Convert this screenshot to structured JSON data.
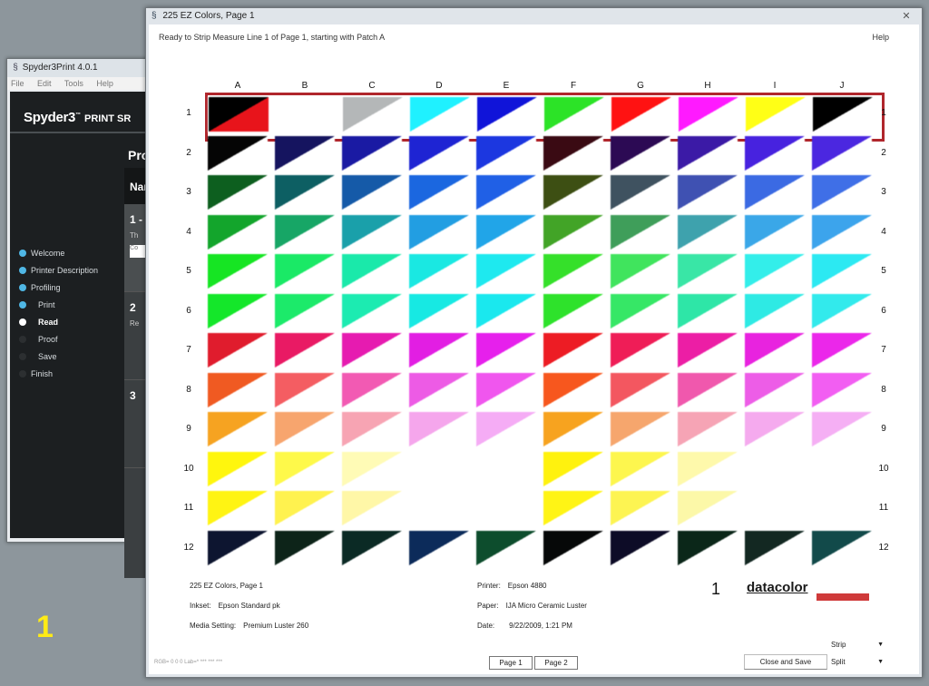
{
  "background_window": {
    "title": "Spyder3Print 4.0.1",
    "menu": [
      "File",
      "Edit",
      "Tools",
      "Help"
    ],
    "logo": "Spyder3",
    "logo_sub": "PRINT SR",
    "heading": "Pro",
    "panel_header": "Nar",
    "steps": [
      {
        "num": "1 -",
        "text": "Th",
        "input": "Co"
      },
      {
        "num": "2",
        "text": "Re"
      },
      {
        "num": "3",
        "text": ""
      }
    ],
    "nav": [
      {
        "label": "Welcome",
        "state": "done"
      },
      {
        "label": "Printer Description",
        "state": "done"
      },
      {
        "label": "Profiling",
        "state": "done"
      },
      {
        "label": "Print",
        "state": "done"
      },
      {
        "label": "Read",
        "state": "current"
      },
      {
        "label": "Proof",
        "state": "pending"
      },
      {
        "label": "Save",
        "state": "pending"
      },
      {
        "label": "Finish",
        "state": "pending"
      }
    ]
  },
  "overlay_number": "1",
  "chart_window": {
    "title": "225 EZ Colors, Page 1",
    "status": "Ready to Strip Measure Line 1 of Page 1, starting with Patch A",
    "help": "Help",
    "columns": [
      "A",
      "B",
      "C",
      "D",
      "E",
      "F",
      "G",
      "H",
      "I",
      "J"
    ],
    "rows": [
      "1",
      "2",
      "3",
      "4",
      "5",
      "6",
      "7",
      "8",
      "9",
      "10",
      "11",
      "12"
    ],
    "active_row": 1,
    "patches": [
      [
        "#000000/#e8141b",
        "#ffffff/#ffffff",
        "#b4b7b8/#ffffff",
        "#1ff1ff/#ffffff",
        "#1014d9/#ffffff",
        "#2ce327/#ffffff",
        "#ff1212/#ffffff",
        "#ff1aff/#ffffff",
        "#ffff16/#ffffff",
        "#000000/#ffffff"
      ],
      [
        "#050505",
        "#15145f",
        "#1a1aa3",
        "#1e24d3",
        "#1c37e0",
        "#3a0a13",
        "#2c0a54",
        "#3b1aa6",
        "#4722df",
        "#4b27e0"
      ],
      [
        "#0d5f1f",
        "#0d5f63",
        "#155aa8",
        "#1b67e0",
        "#2060e6",
        "#3d4f13",
        "#3f5260",
        "#3f51b2",
        "#3b6ae3",
        "#3f6fe7"
      ],
      [
        "#13a52c",
        "#17a666",
        "#1aa0aa",
        "#229ee2",
        "#21a5e8",
        "#42a427",
        "#3f9e5a",
        "#3ea2ad",
        "#3aa7e8",
        "#3ca4ec"
      ],
      [
        "#16e523",
        "#1ae966",
        "#1ae9aa",
        "#1ae8e2",
        "#1ee9ef",
        "#35e02a",
        "#40e45d",
        "#39e6a6",
        "#33eeea",
        "#2ce9f2"
      ],
      [
        "#14e72a",
        "#1cea6a",
        "#1cebb1",
        "#17e9e3",
        "#1ae8ee",
        "#2ee22b",
        "#36e766",
        "#2ee6a7",
        "#2eeae4",
        "#32eaec"
      ],
      [
        "#e01c2d",
        "#e91a64",
        "#e61bb0",
        "#e21ee3",
        "#e620ec",
        "#ed1c24",
        "#ef1d57",
        "#ec1ea5",
        "#e823df",
        "#eb27ea"
      ],
      [
        "#f05a22",
        "#f45d62",
        "#f25ab3",
        "#ed5be5",
        "#f056ee",
        "#f7571e",
        "#f35760",
        "#f058ad",
        "#ed5de7",
        "#f25ef2"
      ],
      [
        "#f6a321",
        "#f7a56e",
        "#f7a4b3",
        "#f5a6ec",
        "#f5acf5",
        "#f7a31f",
        "#f6a66d",
        "#f6a4b5",
        "#f5aaee",
        "#f5aff4"
      ],
      [
        "#fff60d",
        "#fef94a",
        "#fffbb6",
        "#ffffff",
        "#ffffff",
        "#fff20e",
        "#fdf64e",
        "#fef9ab",
        "#ffffff",
        "#ffffff"
      ],
      [
        "#fff413",
        "#fff24f",
        "#fff7a7",
        "#ffffff",
        "#ffffff",
        "#fff415",
        "#fdf452",
        "#fcf8a8",
        "#ffffff",
        "#ffffff"
      ],
      [
        "#0d1530",
        "#0d2419",
        "#0b2a25",
        "#0c2b5a",
        "#0d4d2d",
        "#060808",
        "#0d0c27",
        "#0b2719",
        "#132822",
        "#124a4a"
      ]
    ],
    "footer": {
      "name": "225 EZ Colors, Page 1",
      "inkset_label": "Inkset:",
      "inkset": "Epson Standard pk",
      "media_label": "Media Setting:",
      "media": "Premium Luster 260",
      "printer_label": "Printer:",
      "printer": "Epson 4880",
      "paper_label": "Paper:",
      "paper": "IJA Micro Ceramic Luster",
      "date_label": "Date:",
      "date": "9/22/2009, 1:21 PM",
      "page_number": "1",
      "brand": "datacolor"
    },
    "controls": {
      "strip": "Strip",
      "split": "Split",
      "close_save": "Close and Save",
      "page1": "Page 1",
      "page2": "Page 2",
      "rgb_readout": "RGB= 0 0 0 Lab=* *** *** ***"
    }
  }
}
